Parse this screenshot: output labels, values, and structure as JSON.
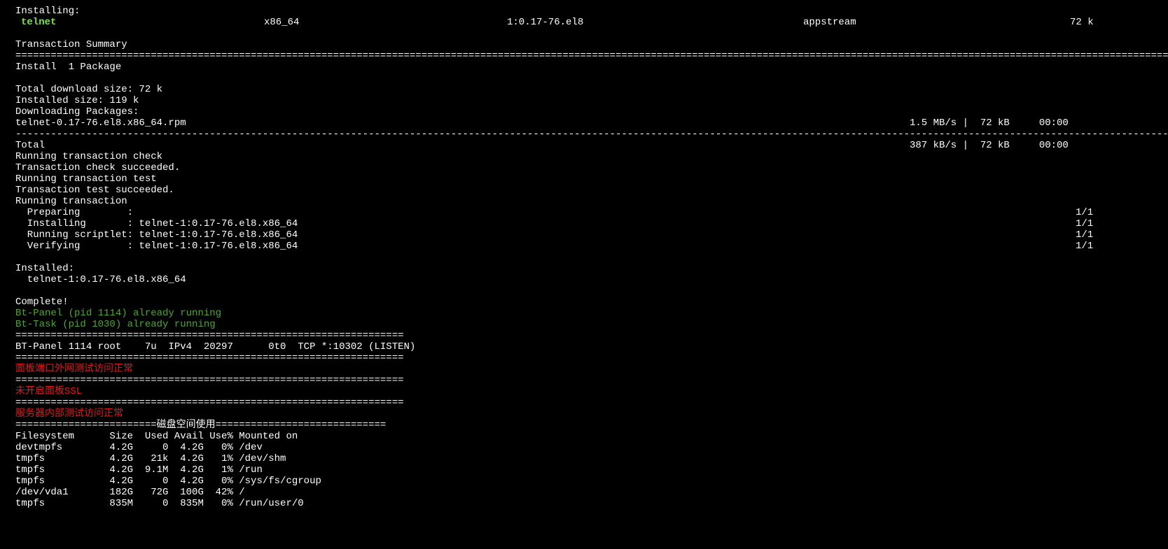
{
  "install_header": "Installing:",
  "pkg_row": {
    "name": "telnet",
    "arch": "x86_64",
    "version": "1:0.17-76.el8",
    "repo": "appstream",
    "size": "72 k"
  },
  "summary_title": "Transaction Summary",
  "sep_eq_long": "====================================================================================================================================================================================================",
  "install_count": "Install  1 Package",
  "total_download": "Total download size: 72 k",
  "installed_size": "Installed size: 119 k",
  "downloading": "Downloading Packages:",
  "rpm_row": {
    "file": "telnet-0.17-76.el8.x86_64.rpm",
    "stats": "1.5 MB/s |  72 kB     00:00"
  },
  "sep_dash_long": "----------------------------------------------------------------------------------------------------------------------------------------------------------------------------------------------------------------",
  "total_row": {
    "label": "Total",
    "stats": "387 kB/s |  72 kB     00:00"
  },
  "tx_lines": [
    "Running transaction check",
    "Transaction check succeeded.",
    "Running transaction test",
    "Transaction test succeeded.",
    "Running transaction"
  ],
  "steps": [
    {
      "text": "  Preparing        :",
      "count": "1/1"
    },
    {
      "text": "  Installing       : telnet-1:0.17-76.el8.x86_64",
      "count": "1/1"
    },
    {
      "text": "  Running scriptlet: telnet-1:0.17-76.el8.x86_64",
      "count": "1/1"
    },
    {
      "text": "  Verifying        : telnet-1:0.17-76.el8.x86_64",
      "count": "1/1"
    }
  ],
  "installed_header": "Installed:",
  "installed_pkg": "  telnet-1:0.17-76.el8.x86_64",
  "complete": "Complete!",
  "bt_panel_running": "Bt-Panel (pid 1114) already running",
  "bt_task_running": "Bt-Task (pid 1030) already running",
  "sep_eq_short": "==================================================================",
  "listen_line": "BT-Panel 1114 root    7u  IPv4  20297      0t0  TCP *:10302 (LISTEN)",
  "msg_panel_port": "面板端口外网测试访问正常",
  "msg_ssl": "未开启面板SSL",
  "msg_internal": "服务器内部测试访问正常",
  "disk_sep_left": "========================",
  "disk_title": "磁盘空间使用",
  "disk_sep_right": "=============================",
  "df_header": "Filesystem      Size  Used Avail Use% Mounted on",
  "df_rows": [
    "devtmpfs        4.2G     0  4.2G   0% /dev",
    "tmpfs           4.2G   21k  4.2G   1% /dev/shm",
    "tmpfs           4.2G  9.1M  4.2G   1% /run",
    "tmpfs           4.2G     0  4.2G   0% /sys/fs/cgroup",
    "/dev/vda1       182G   72G  100G  42% /",
    "tmpfs           835M     0  835M   0% /run/user/0"
  ]
}
